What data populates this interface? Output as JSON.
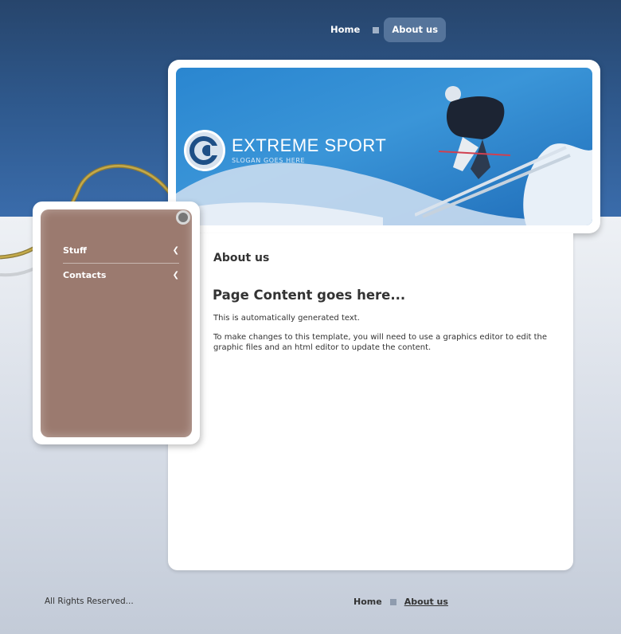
{
  "topnav": {
    "items": [
      {
        "label": "Home",
        "active": false
      },
      {
        "label": "About us",
        "active": true
      }
    ]
  },
  "banner": {
    "brand": "EXTREME SPORT",
    "slogan": "SLOGAN GOES HERE"
  },
  "sidebar": {
    "items": [
      {
        "label": "Stuff",
        "icon": "chevron-left-icon"
      },
      {
        "label": "Contacts",
        "icon": "chevron-left-icon"
      }
    ]
  },
  "content": {
    "section_title": "About us",
    "page_title": "Page Content goes here...",
    "paragraphs": [
      "This is automatically generated text.",
      "To make changes to this template, you will need to use a graphics editor to edit the graphic files and an html editor to update the content."
    ]
  },
  "footer": {
    "copyright": "All Rights Reserved...",
    "nav": [
      {
        "label": "Home",
        "active": false
      },
      {
        "label": "About us",
        "active": true
      }
    ]
  },
  "colors": {
    "header_dark": "#27456c",
    "tag_brown": "#9b7a6f",
    "banner_blue": "#2a86d0"
  }
}
